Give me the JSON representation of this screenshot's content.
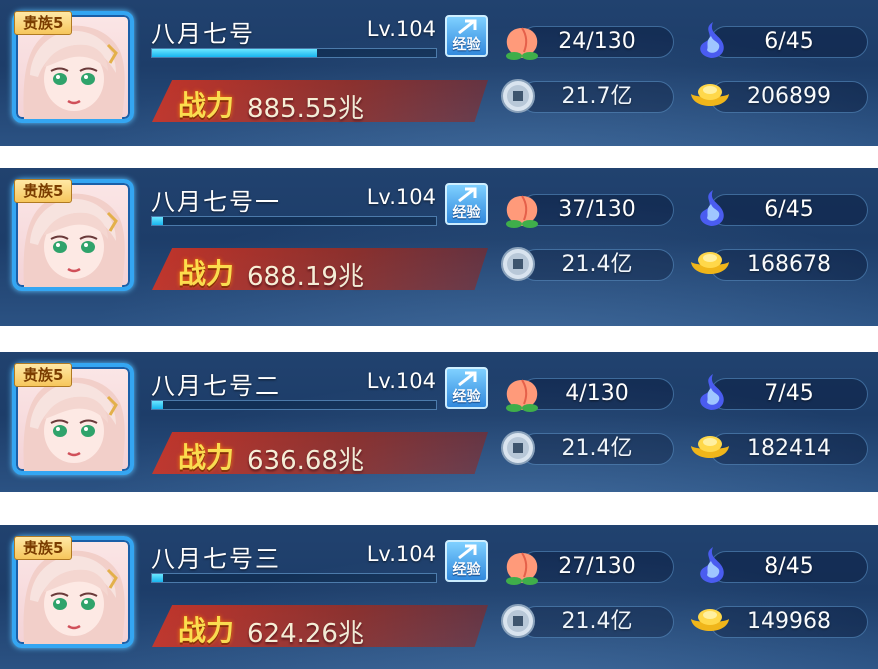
{
  "colors": {
    "exp_fill": "#18b5ef",
    "power_label": "#ffde4a",
    "panel_bg": "#1d3d69"
  },
  "exp_label": "经验",
  "power_label": "战力",
  "icons": {
    "peach": "peach-icon",
    "spirit": "blue-flame-icon",
    "coin": "copper-coin-icon",
    "ingot": "gold-ingot-icon"
  },
  "panels": [
    {
      "badge": "贵族5",
      "name": "八月七号",
      "level": "Lv.104",
      "exp_ratio": 0.58,
      "power": "885.55兆",
      "peach": "24/130",
      "spirit": "6/45",
      "coins": "21.7亿",
      "gold": "206899"
    },
    {
      "badge": "贵族5",
      "name": "八月七号一",
      "level": "Lv.104",
      "exp_ratio": 0.04,
      "power": "688.19兆",
      "peach": "37/130",
      "spirit": "6/45",
      "coins": "21.4亿",
      "gold": "168678"
    },
    {
      "badge": "贵族5",
      "name": "八月七号二",
      "level": "Lv.104",
      "exp_ratio": 0.04,
      "power": "636.68兆",
      "peach": "4/130",
      "spirit": "7/45",
      "coins": "21.4亿",
      "gold": "182414"
    },
    {
      "badge": "贵族5",
      "name": "八月七号三",
      "level": "Lv.104",
      "exp_ratio": 0.04,
      "power": "624.26兆",
      "peach": "27/130",
      "spirit": "8/45",
      "coins": "21.4亿",
      "gold": "149968"
    }
  ]
}
